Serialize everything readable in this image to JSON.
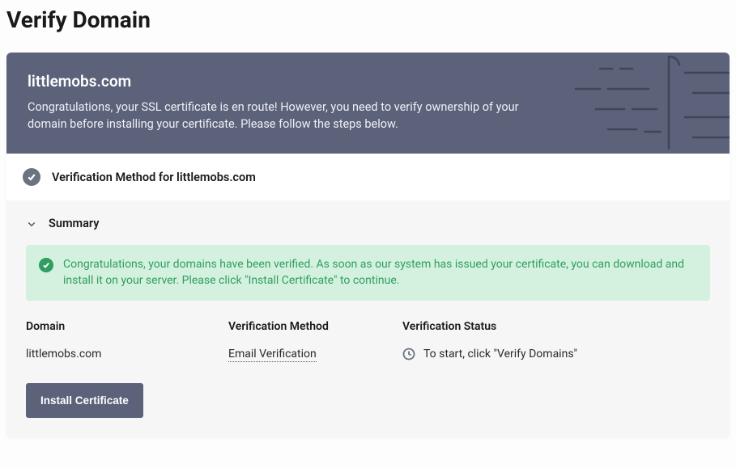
{
  "page": {
    "title": "Verify Domain"
  },
  "banner": {
    "domain": "littlemobs.com",
    "message": "Congratulations, your SSL certificate is en route! However, you need to verify ownership of your domain before installing your certificate. Please follow the steps below."
  },
  "verification": {
    "heading": "Verification Method for littlemobs.com"
  },
  "summary": {
    "title": "Summary",
    "success_message": "Congratulations, your domains have been verified. As soon as our system has issued your certificate, you can download and install it on your server. Please click \"Install Certificate\" to continue."
  },
  "table": {
    "headers": {
      "domain": "Domain",
      "method": "Verification Method",
      "status": "Verification Status"
    },
    "rows": [
      {
        "domain": "littlemobs.com",
        "method": "Email Verification",
        "status": "To start, click \"Verify Domains\""
      }
    ]
  },
  "actions": {
    "install": "Install Certificate"
  }
}
